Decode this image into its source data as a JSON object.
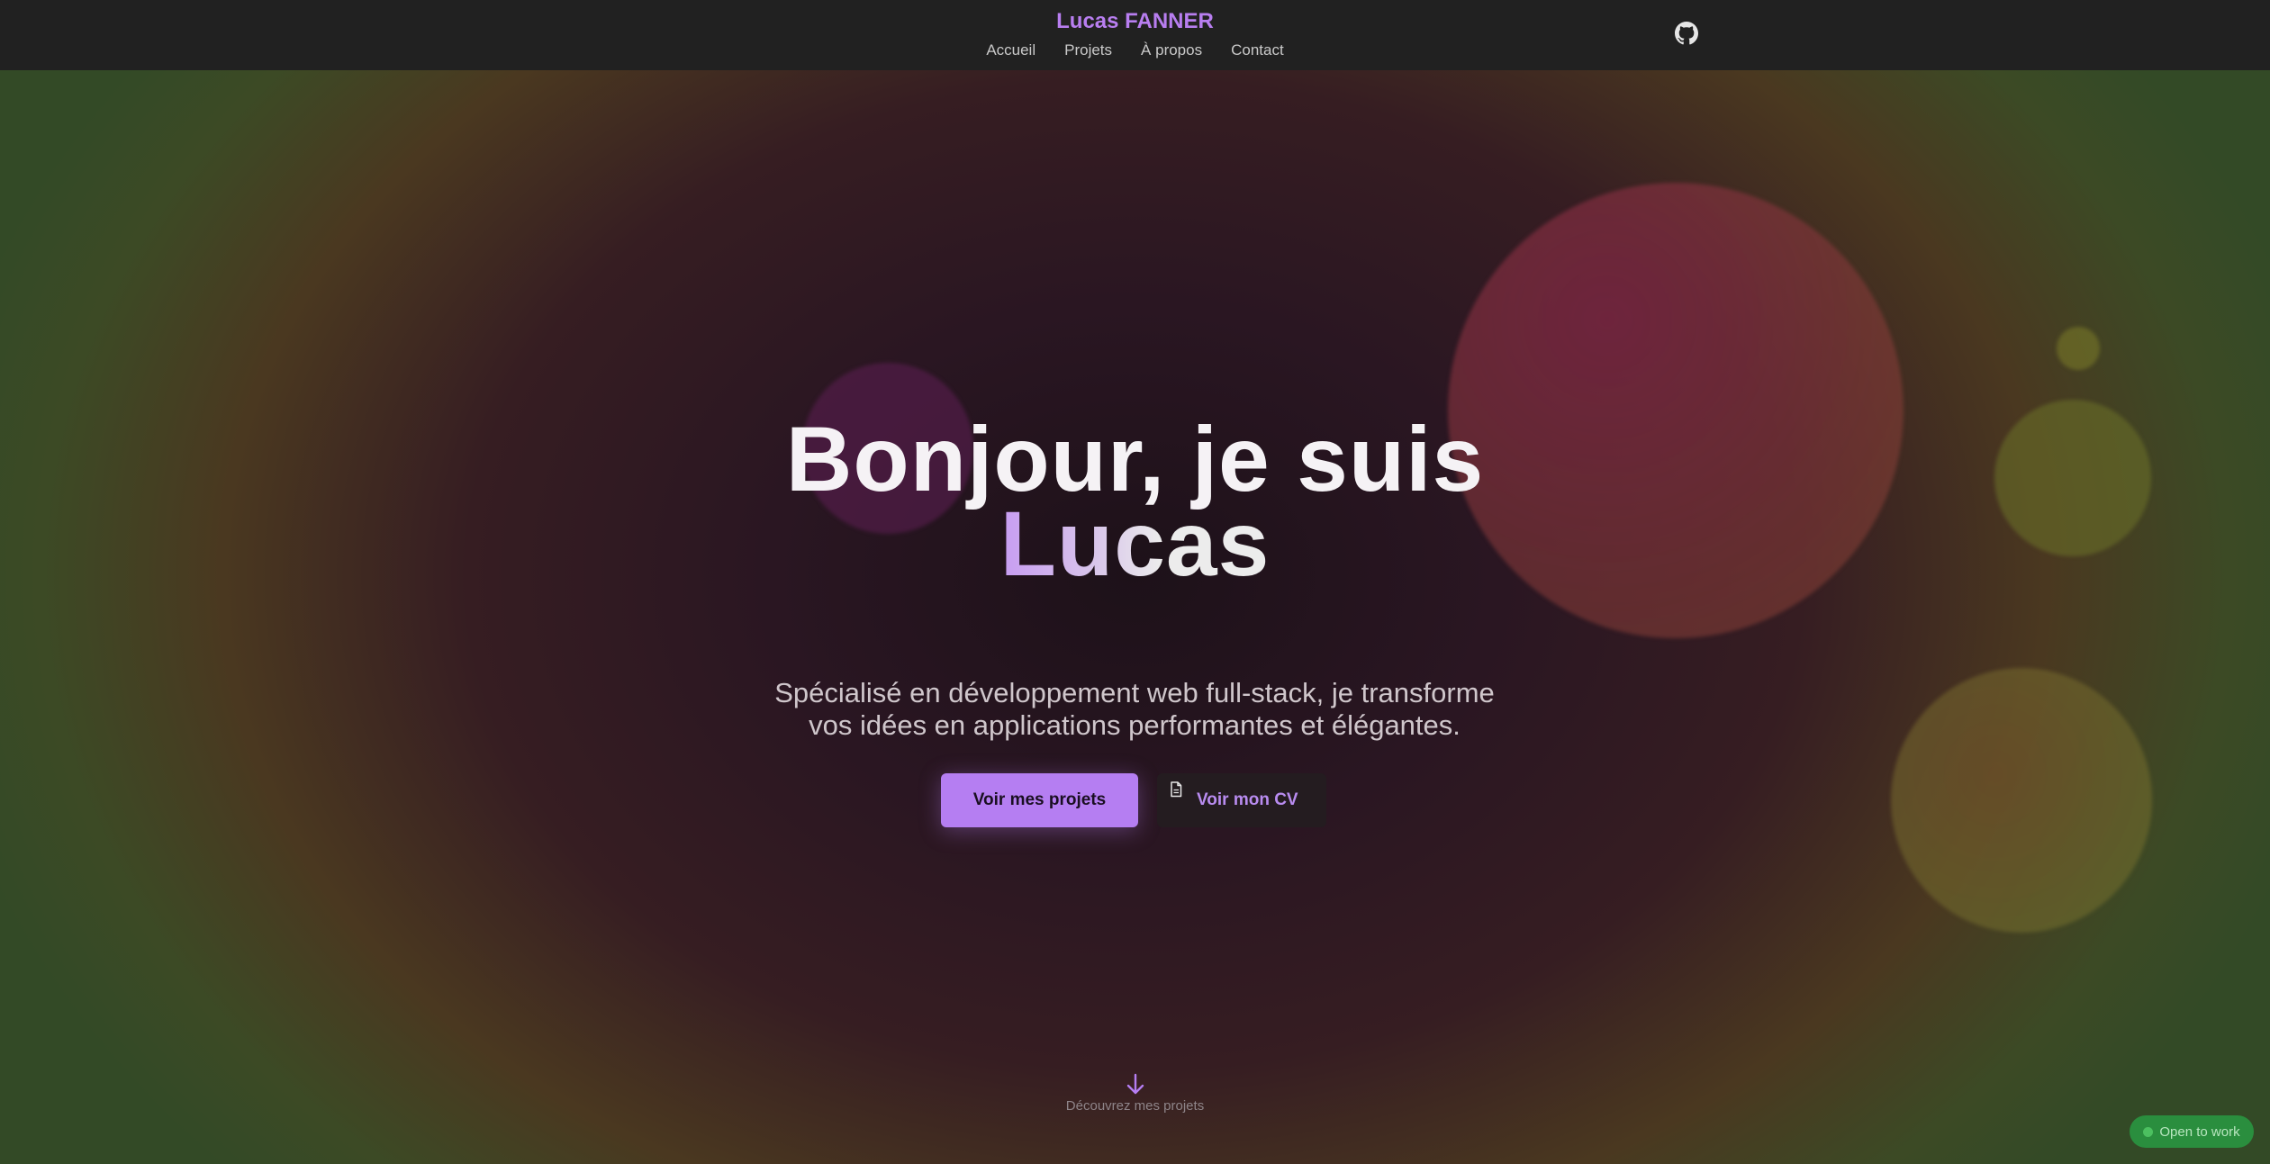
{
  "header": {
    "brand": "Lucas FANNER",
    "nav": [
      {
        "label": "Accueil"
      },
      {
        "label": "Projets"
      },
      {
        "label": "À propos"
      },
      {
        "label": "Contact"
      }
    ],
    "github_icon": "github-icon"
  },
  "hero": {
    "title_line1": "Bonjour, je suis",
    "title_name": "Lucas",
    "subtitle_line1": "Spécialisé en développement web full-stack, je transforme",
    "subtitle_line2": "vos idées en applications performantes et élégantes.",
    "primary_button": "Voir mes projets",
    "secondary_button": "Voir mon CV",
    "secondary_icon": "file-icon",
    "scroll_hint": "Découvrez mes projets",
    "scroll_icon": "arrow-down-icon"
  },
  "status_badge": {
    "label": "Open to work",
    "color": "#2a8e3e"
  },
  "colors": {
    "accent": "#b57ef2",
    "header_bg": "#212121"
  }
}
